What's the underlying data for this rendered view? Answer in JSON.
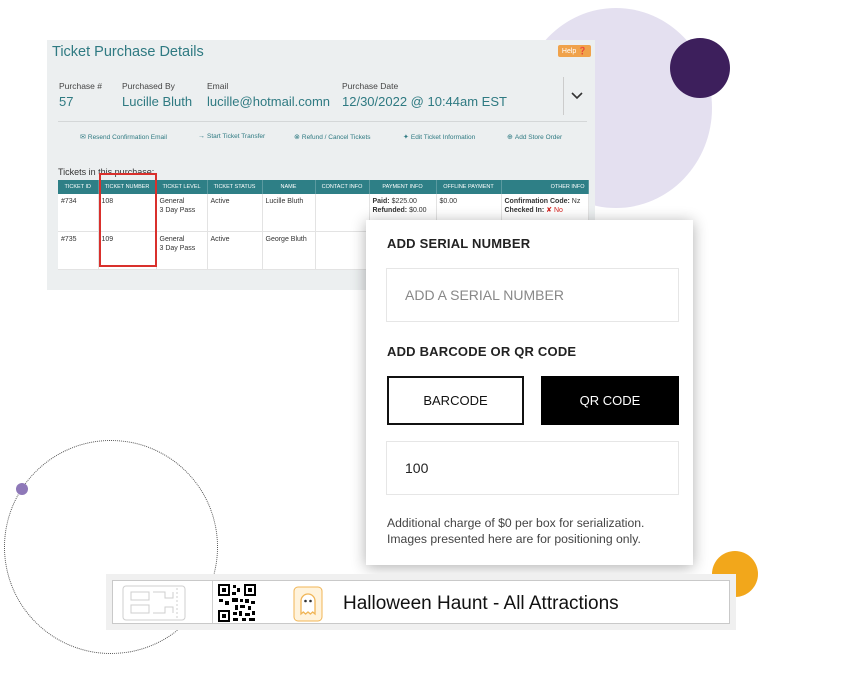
{
  "colors": {
    "teal": "#2f7a82",
    "table_header": "#2e7f86",
    "highlight_red": "#d9302c",
    "help_orange": "#f0a24a",
    "accent_purple": "#3d1f5c",
    "accent_lavender": "#e4e0f0",
    "accent_orange": "#f2a71b"
  },
  "panel": {
    "title": "Ticket Purchase Details",
    "help_label": "Help",
    "help_icon": "question-circle-icon",
    "purchase_num_label": "Purchase #",
    "purchase_num": "57",
    "purchased_by_label": "Purchased By",
    "purchased_by": "Lucille Bluth",
    "email_label": "Email",
    "email": "lucille@hotmail.comn",
    "purchase_date_label": "Purchase Date",
    "purchase_date": "12/30/2022 @ 10:44am EST",
    "expand_icon": "chevron-down-icon",
    "actions": [
      {
        "label": "Resend Confirmation Email",
        "icon": "envelope-icon"
      },
      {
        "label": "Start Ticket Transfer",
        "icon": "arrow-right-icon"
      },
      {
        "label": "Refund / Cancel Tickets",
        "icon": "cancel-circle-icon"
      },
      {
        "label": "Edit Ticket Information",
        "icon": "tags-icon"
      },
      {
        "label": "Add Store Order",
        "icon": "plus-circle-icon"
      }
    ],
    "tickets_heading": "Tickets in this purchase:",
    "table": {
      "headers": [
        "TICKET ID",
        "TICKET NUMBER",
        "TICKET LEVEL",
        "TICKET STATUS",
        "NAME",
        "CONTACT INFO",
        "PAYMENT INFO",
        "OFFLINE PAYMENT",
        "OTHER INFO"
      ],
      "rows": [
        {
          "id": "#734",
          "number": "108",
          "level_1": "General",
          "level_2": "3 Day Pass",
          "status": "Active",
          "name": "Lucille Bluth",
          "contact": "",
          "paid_label": "Paid:",
          "paid": "$225.00",
          "refunded_label": "Refunded:",
          "refunded": "$0.00",
          "offline": "$0.00",
          "conf_label": "Confirmation Code:",
          "conf_value": "Nz",
          "checked_label": "Checked In:",
          "checked_mark": "✘",
          "checked_value": "No"
        },
        {
          "id": "#735",
          "number": "109",
          "level_1": "General",
          "level_2": "3 Day Pass",
          "status": "Active",
          "name": "George Bluth",
          "contact": "",
          "offline": ""
        }
      ]
    }
  },
  "serial_card": {
    "serial_heading": "ADD SERIAL NUMBER",
    "serial_placeholder": "ADD A SERIAL NUMBER",
    "code_heading": "ADD BARCODE OR QR CODE",
    "barcode_label": "BARCODE",
    "qrcode_label": "QR CODE",
    "quantity_value": "100",
    "note_line1": "Additional charge of $0 per box for serialization.",
    "note_line2": "Images presented here are for positioning only."
  },
  "label_strip": {
    "title": "Halloween Haunt - All Attractions",
    "qr_icon": "qr-code-icon",
    "ghost_icon": "ghost-icon",
    "ticket_outline_icon": "ticket-outline-icon"
  }
}
